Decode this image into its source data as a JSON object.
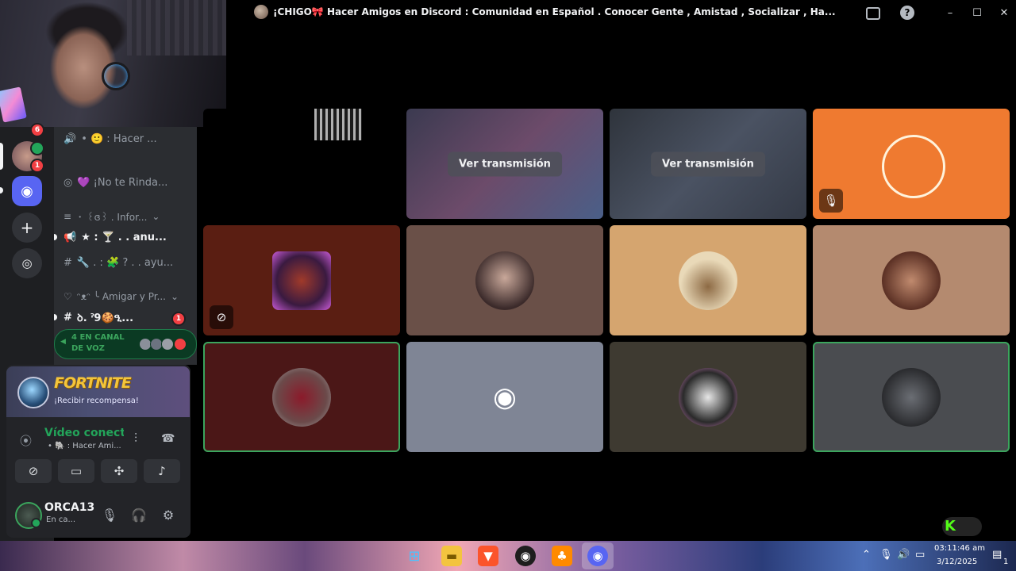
{
  "window": {
    "title": "¡CHIGO🎀 Hacer Amigos en Discord : Comunidad en Español . Conocer Gente , Amistad , Socializar , Ha...",
    "controls": [
      "–",
      "☐",
      "✕"
    ]
  },
  "sidebar": {
    "badges": {
      "server_top": "6",
      "server_a": "1"
    },
    "channels": [
      {
        "icon": "🔊",
        "label": "• 🙂 : Hacer ..."
      },
      {
        "icon": "◎",
        "label": "💜 ¡No te Rinda..."
      },
      {
        "icon": "≡",
        "label": "・ ꒰ɞ꒱ . Infor...",
        "category": true
      },
      {
        "icon": "📢",
        "label": "★ : 🍸 . . anu..."
      },
      {
        "icon": "#",
        "label": "🔧 . : 🧩 ? . . ayu..."
      },
      {
        "icon": "♡",
        "label": "ᵔᴥᵔ ╰ Amigar y Pr...",
        "category": true
      },
      {
        "icon": "#",
        "label": "ꝺ. ˀ9🍪ዒ...",
        "badge": "1"
      }
    ],
    "voice_pill": {
      "label": "4 EN CANAL DE VOZ"
    }
  },
  "game_card": {
    "name": "FORTNITE",
    "reward": "¡Recibir recompensa!"
  },
  "voice_connection": {
    "status": "Vídeo conectad",
    "channel": "• 🐘 : Hacer Ami..."
  },
  "user": {
    "name": "ORCA13",
    "status": "En ca..."
  },
  "tiles": {
    "stream_label": "Ver transmisión",
    "colors": [
      "#000000",
      "#5b4a3d",
      "#3a3f47",
      "#ef7a30",
      "#5a1e12",
      "#6a5048",
      "#d5a56f",
      "#b48a6f",
      "#4b1717",
      "#7f8595",
      "#3e3a31",
      "#4a4c50"
    ]
  },
  "taskbar": {
    "time": "03:11:46 am",
    "date": "3/12/2025",
    "notifications": "1"
  }
}
